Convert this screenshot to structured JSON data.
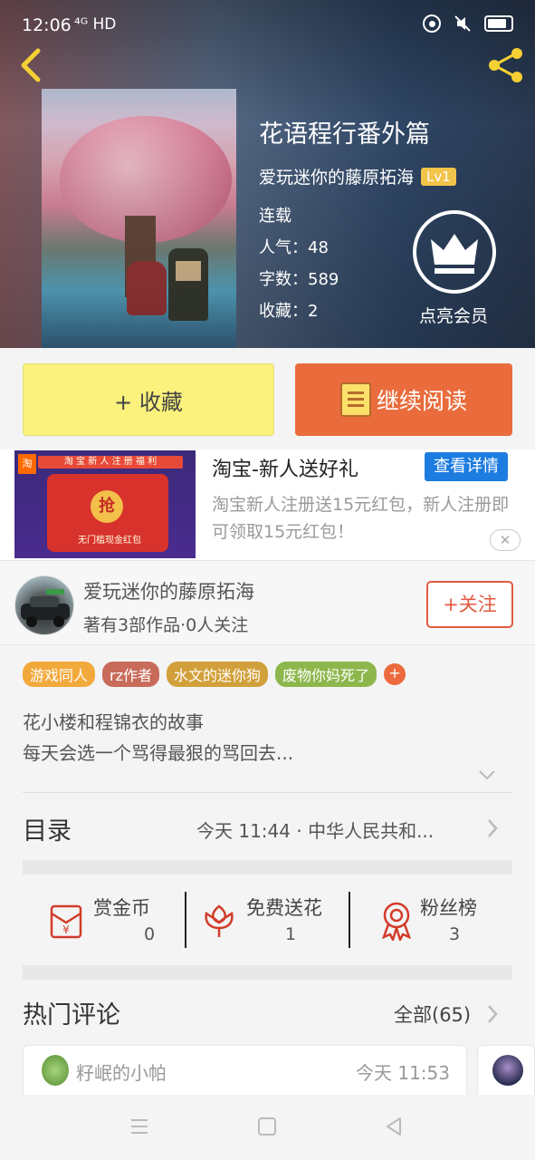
{
  "status_bar": {
    "time": "12:06",
    "network": "⁴ᴳ HD"
  },
  "book": {
    "title": "花语程行番外篇",
    "author": "爱玩迷你的藤原拓海",
    "level": "Lv1",
    "status": "连载",
    "popularity": "人气：48",
    "word_count": "字数：589",
    "favorites": "收藏：2"
  },
  "vip": {
    "label": "点亮会员"
  },
  "actions": {
    "collect_label": "+ 收藏",
    "read_label": "继续阅读"
  },
  "ad": {
    "image_banner": "淘 宝 新 人 注 册 福 利",
    "image_coin": "抢",
    "image_text": "无门槛现金红包",
    "title": "淘宝-新人送好礼",
    "detail_label": "查看详情",
    "description": "淘宝新人注册送15元红包，新人注册即可领取15元红包！",
    "close": "✕"
  },
  "author_card": {
    "name": "爱玩迷你的藤原拓海",
    "stats": "著有3部作品·0人关注",
    "follow_label": "+关注"
  },
  "tags": [
    {
      "label": "游戏同人",
      "color": "#f2a93b"
    },
    {
      "label": "rz作者",
      "color": "#c96b5b"
    },
    {
      "label": "水文的迷你狗",
      "color": "#d2a03a"
    },
    {
      "label": "废物你妈死了",
      "color": "#8db74c"
    }
  ],
  "tags_more": "+",
  "intro": {
    "line1": "花小楼和程锦衣的故事",
    "line2": "每天会选一个骂得最狠的骂回去..."
  },
  "toc": {
    "label": "目录",
    "latest": "今天 11:44 · 中华人民共和..."
  },
  "stats": [
    {
      "label": "赏金币",
      "value": "0",
      "icon": "red-envelope-icon"
    },
    {
      "label": "免费送花",
      "value": "1",
      "icon": "flower-icon"
    },
    {
      "label": "粉丝榜",
      "value": "3",
      "icon": "medal-icon"
    }
  ],
  "hot_comments": {
    "label": "热门评论",
    "all_label": "全部(65)"
  },
  "comments": [
    {
      "name": "籽岷的小帕",
      "time": "今天 11:53"
    }
  ],
  "colors": {
    "accent_orange": "#ea6c3c",
    "collect_yellow": "#fbf27d",
    "detail_blue": "#1d7ce0",
    "stat_red": "#d23c2a"
  }
}
